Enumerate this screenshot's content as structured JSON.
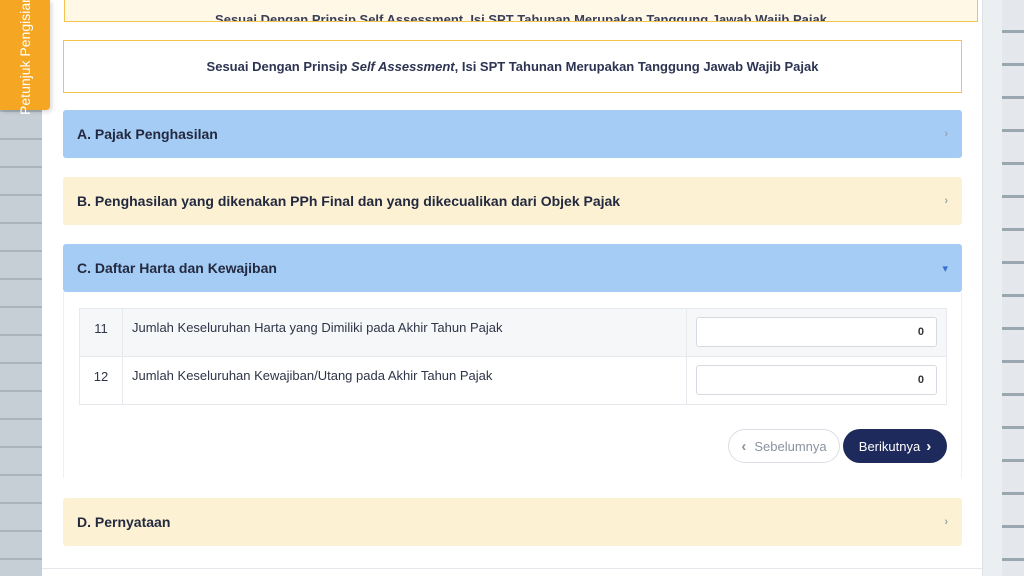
{
  "sidebar_tab": {
    "label": "Petunjuk Pengisian"
  },
  "top_notice_cut": "Sesuai Dengan Prinsip Self Assessment, Isi SPT Tahunan Merupakan Tanggung Jawab Wajib Pajak",
  "notice": {
    "prefix": "Sesuai Dengan Prinsip ",
    "emphasis": "Self Assessment",
    "suffix": ", Isi SPT Tahunan Merupakan Tanggung Jawab Wajib Pajak"
  },
  "sections": [
    {
      "label": "A. Pajak Penghasilan",
      "state": "collapsed"
    },
    {
      "label": "B. Penghasilan yang dikenakan PPh Final dan yang dikecualikan dari Objek Pajak",
      "state": "collapsed"
    },
    {
      "label": "C. Daftar Harta dan Kewajiban",
      "state": "expanded"
    },
    {
      "label": "D. Pernyataan",
      "state": "collapsed"
    }
  ],
  "items": [
    {
      "num": "11",
      "label": "Jumlah Keseluruhan Harta yang Dimiliki pada Akhir Tahun Pajak",
      "value": "0"
    },
    {
      "num": "12",
      "label": "Jumlah Keseluruhan Kewajiban/Utang pada Akhir Tahun Pajak",
      "value": "0"
    }
  ],
  "buttons": {
    "prev": "Sebelumnya",
    "next": "Berikutnya"
  },
  "icons": {
    "chevron_right": "›",
    "chevron_down": "▾",
    "prev": "‹",
    "next": "›"
  },
  "colors": {
    "accent_orange": "#f5a623",
    "section_blue": "#a4ccf4",
    "section_yellow": "#fdf1d4",
    "primary_navy": "#1e2a5c"
  }
}
